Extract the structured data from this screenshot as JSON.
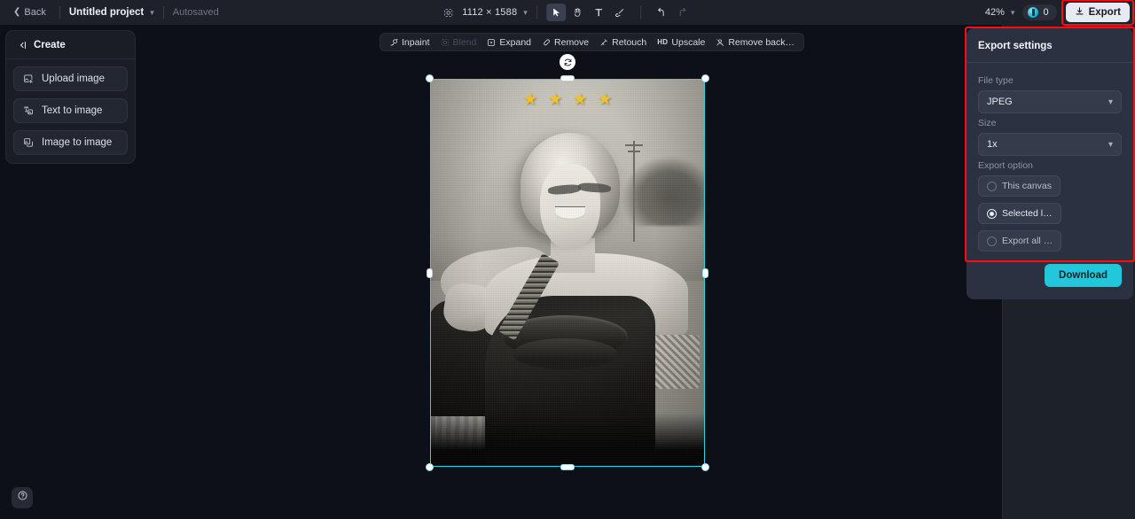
{
  "topbar": {
    "back_label": "Back",
    "project_name": "Untitled project",
    "autosaved_label": "Autosaved",
    "canvas_dimensions": "1112 × 1588",
    "zoom_level": "42%",
    "credits_count": "0",
    "export_label": "Export",
    "tools": [
      {
        "name": "select-tool",
        "icon": "cursor-icon",
        "active": true
      },
      {
        "name": "hand-tool",
        "icon": "hand-icon",
        "active": false
      },
      {
        "name": "text-tool",
        "icon": "text-icon",
        "active": false
      },
      {
        "name": "brush-tool",
        "icon": "brush-icon",
        "active": false
      },
      {
        "name": "undo-tool",
        "icon": "undo-icon",
        "active": false
      },
      {
        "name": "redo-tool",
        "icon": "redo-icon",
        "active": false
      }
    ]
  },
  "left_panel": {
    "title": "Create",
    "collapse_icon": "collapse-left-icon",
    "items": [
      {
        "label": "Upload image",
        "icon": "upload-image-icon"
      },
      {
        "label": "Text to image",
        "icon": "text-to-image-icon"
      },
      {
        "label": "Image to image",
        "icon": "image-to-image-icon"
      }
    ]
  },
  "canvas_toolbar": {
    "items": [
      {
        "label": "Inpaint",
        "icon": "inpaint-icon",
        "disabled": false
      },
      {
        "label": "Blend",
        "icon": "blend-icon",
        "disabled": true
      },
      {
        "label": "Expand",
        "icon": "expand-icon",
        "disabled": false
      },
      {
        "label": "Remove",
        "icon": "remove-icon",
        "disabled": false
      },
      {
        "label": "Retouch",
        "icon": "retouch-icon",
        "disabled": false
      },
      {
        "label": "Upscale",
        "icon": "hd-icon",
        "disabled": false
      },
      {
        "label": "Remove back…",
        "icon": "remove-background-icon",
        "disabled": false
      }
    ]
  },
  "canvas": {
    "selection_color": "#24d6e8",
    "image_description": "Vintage black and white portrait photograph of a smiling woman in a dark one-shoulder dress",
    "star_overlay_count": 4,
    "star_color": "#f0c22a",
    "star_glyph": "★",
    "rotate_handle_icon": "rotate-icon"
  },
  "export_panel": {
    "title": "Export settings",
    "highlight_color": "#ff0a16",
    "file_type": {
      "label": "File type",
      "value": "JPEG"
    },
    "size": {
      "label": "Size",
      "value": "1x"
    },
    "export_option": {
      "label": "Export option",
      "options": [
        {
          "label": "This canvas",
          "selected": false
        },
        {
          "label": "Selected l…",
          "selected": true
        },
        {
          "label": "Export all …",
          "selected": false
        }
      ]
    },
    "download_label": "Download",
    "download_color": "#22c7dd"
  },
  "help": {
    "icon": "help-icon"
  }
}
